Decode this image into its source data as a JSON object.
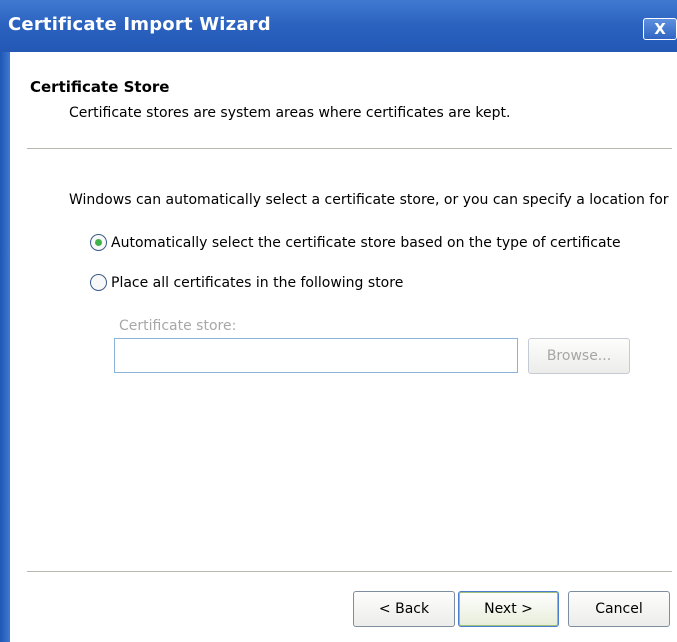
{
  "window": {
    "title": "Certificate Import Wizard",
    "close_label": "X"
  },
  "header": {
    "title": "Certificate Store",
    "subtitle": "Certificate stores are system areas where certificates are kept."
  },
  "body": {
    "intro": "Windows can automatically select a certificate store, or you can specify a location for",
    "options": [
      {
        "label": "Automatically select the certificate store based on the type of certificate",
        "selected": true
      },
      {
        "label": "Place all certificates in the following store",
        "selected": false
      }
    ],
    "store_label": "Certificate store:",
    "store_value": "",
    "browse_label": "Browse..."
  },
  "footer": {
    "back_label": "< Back",
    "next_label": "Next >",
    "cancel_label": "Cancel"
  },
  "colors": {
    "titlebar": "#2c63c0",
    "radio_selected": "#3fb34a",
    "input_border": "#8bb3da"
  }
}
